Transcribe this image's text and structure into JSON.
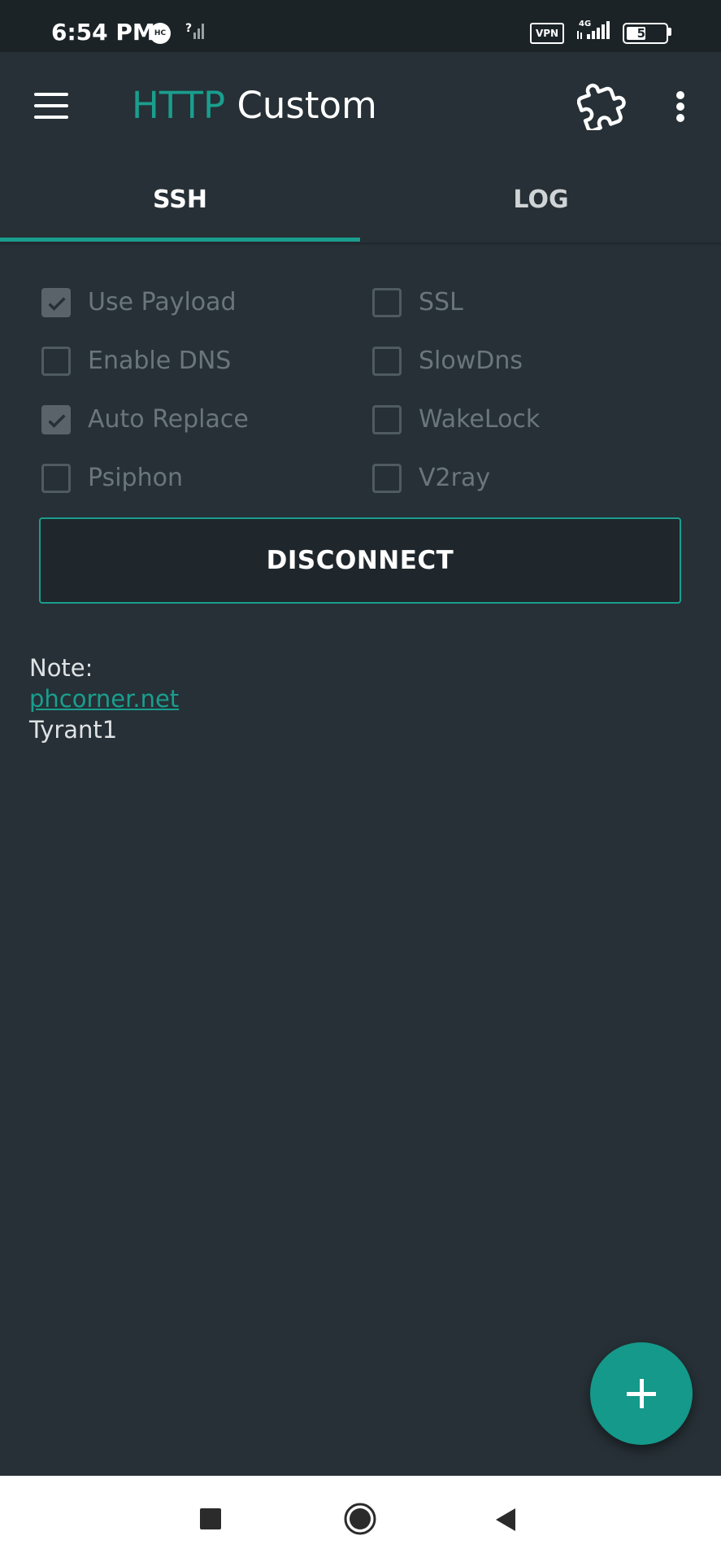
{
  "status_bar": {
    "time": "6:54 PM",
    "hc_badge": "HC",
    "vpn_label": "VPN",
    "network_label": "4G",
    "battery_level": "51"
  },
  "app_bar": {
    "title_accent": "HTTP",
    "title_main": " Custom",
    "accent_color": "#1a9e8e"
  },
  "tabs": [
    {
      "label": "SSH",
      "selected": true
    },
    {
      "label": "LOG",
      "selected": false
    }
  ],
  "options": [
    {
      "label": "Use Payload",
      "checked": true
    },
    {
      "label": "SSL",
      "checked": false
    },
    {
      "label": "Enable DNS",
      "checked": false
    },
    {
      "label": "SlowDns",
      "checked": false
    },
    {
      "label": "Auto Replace",
      "checked": true
    },
    {
      "label": "WakeLock",
      "checked": false
    },
    {
      "label": "Psiphon",
      "checked": false
    },
    {
      "label": "V2ray",
      "checked": false
    }
  ],
  "connect_button_label": "DISCONNECT",
  "note": {
    "heading": "Note:",
    "link": "phcorner.net",
    "line": "Tyrant1"
  },
  "icons": {
    "menu": "menu-icon",
    "plugin": "puzzle-icon",
    "more": "more-vert-icon",
    "fab": "add-icon",
    "check": "check-icon"
  }
}
